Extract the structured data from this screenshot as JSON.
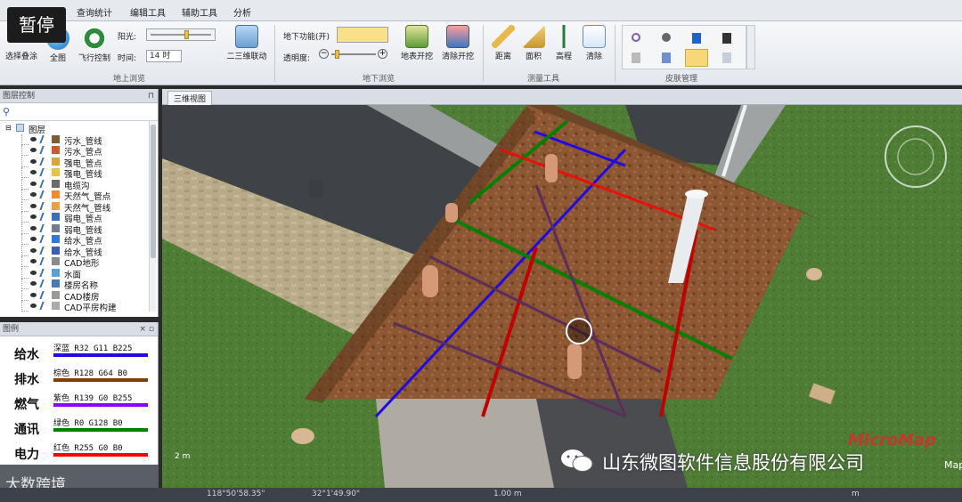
{
  "ribbon": {
    "tabs": [
      "查询统计",
      "编辑工具",
      "辅助工具",
      "分析"
    ],
    "pause_badge": "暂停",
    "groups": {
      "surface": {
        "label": "地上浏览",
        "buttons": [
          "选择叠涂",
          "全图",
          "飞行控制"
        ],
        "sun_label": "阳光:",
        "time_label": "时间:",
        "time_value": "14 时",
        "dual_view": "二三维联动"
      },
      "underground": {
        "label": "地下浏览",
        "func_label": "地下功能(开)",
        "opacity_label": "透明度:",
        "buttons": [
          "地表开挖",
          "清除开挖"
        ]
      },
      "measure": {
        "label": "测量工具",
        "buttons": [
          "距离",
          "面积",
          "高程",
          "清除"
        ]
      },
      "skin": {
        "label": "皮肤管理"
      }
    }
  },
  "layer_panel": {
    "title": "图层控制",
    "root": "图层",
    "items": [
      "污水_管线",
      "污水_管点",
      "强电_管点",
      "强电_管线",
      "电缆沟",
      "天然气_管点",
      "天然气_管线",
      "弱电_管点",
      "弱电_管线",
      "给水_管点",
      "给水_管线",
      "CAD地形",
      "水面",
      "楼房名称",
      "CAD楼房",
      "CAD平房构建"
    ]
  },
  "legend": {
    "title": "图例",
    "items": [
      {
        "name": "给水",
        "desc": "深蓝 R32 G11 B225",
        "color": "#200be1"
      },
      {
        "name": "排水",
        "desc": "棕色 R128 G64 B0",
        "color": "#804000"
      },
      {
        "name": "燃气",
        "desc": "紫色 R139 G0 B255",
        "color": "#8b00ff"
      },
      {
        "name": "通讯",
        "desc": "绿色 R0 G128 B0",
        "color": "#008000"
      },
      {
        "name": "电力",
        "desc": "红色 R255 G0 B0",
        "color": "#ff0000"
      }
    ]
  },
  "viewport": {
    "tab": "三维视图",
    "scale": "2 m"
  },
  "status": {
    "lon": "118°50'58.35\"",
    "lat": "32°1'49.90\"",
    "alt": "1.00 m",
    "unit": "m"
  },
  "watermarks": {
    "left": "大数跨境",
    "company": "山东微图软件信息股份有限公司",
    "brand": "MicroMap",
    "brand_suffix": "Map"
  },
  "colors": {
    "water": "#200be1",
    "drain": "#804000",
    "gas": "#8b00ff",
    "telecom": "#008000",
    "power": "#ff0000"
  }
}
